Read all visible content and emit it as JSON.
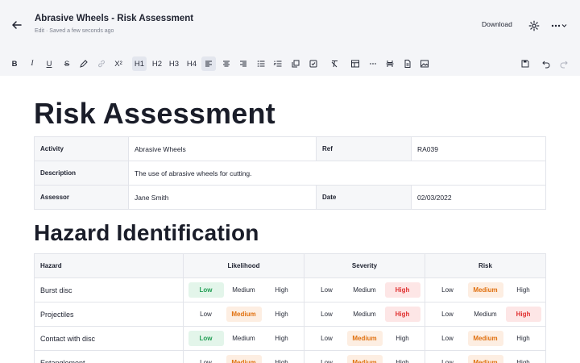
{
  "header": {
    "title": "Abrasive Wheels - Risk Assessment",
    "subtitle": "Edit · Saved a few seconds ago",
    "download_label": "Download"
  },
  "toolbar": {
    "heading_labels": [
      "H1",
      "H2",
      "H3",
      "H4"
    ],
    "superscript_label": "X²"
  },
  "document": {
    "title": "Risk Assessment",
    "info_rows": [
      {
        "label1": "Activity",
        "value1": "Abrasive Wheels",
        "label2": "Ref",
        "value2": "RA039"
      },
      {
        "label1": "Description",
        "value1": "The use of abrasive wheels for cutting.",
        "label2": "",
        "value2": ""
      },
      {
        "label1": "Assessor",
        "value1": "Jane Smith",
        "label2": "Date",
        "value2": "02/03/2022"
      }
    ],
    "hazard_heading": "Hazard Identification",
    "hazard_columns": [
      "Hazard",
      "Likelihood",
      "Severity",
      "Risk"
    ],
    "levels": [
      "Low",
      "Medium",
      "High"
    ],
    "hazards": [
      {
        "name": "Burst disc",
        "likelihood": "Low",
        "severity": "High",
        "risk": "Medium"
      },
      {
        "name": "Projectiles",
        "likelihood": "Medium",
        "severity": "High",
        "risk": "High"
      },
      {
        "name": "Contact with disc",
        "likelihood": "Low",
        "severity": "Medium",
        "risk": "Medium"
      },
      {
        "name": "Entanglement",
        "likelihood": "Medium",
        "severity": "Medium",
        "risk": "Medium"
      }
    ]
  },
  "colors": {
    "low": "#1f9d52",
    "medium": "#e0700f",
    "high": "#e03131",
    "header_bg": "#f4f5f8"
  }
}
